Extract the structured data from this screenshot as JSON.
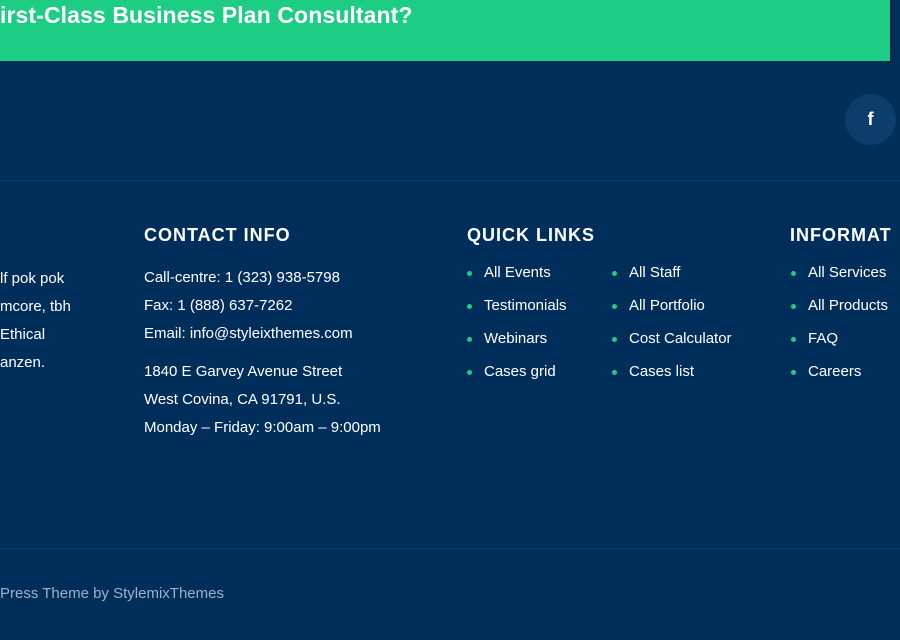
{
  "cta": {
    "title": "irst-Class Business Plan Consultant?"
  },
  "social": {
    "facebook_icon": "f"
  },
  "about": {
    "lines": [
      "lf pok pok",
      "mcore, tbh",
      "Ethical",
      "anzen."
    ]
  },
  "contact": {
    "title": "CONTACT INFO",
    "phone": "Call-centre: 1 (323) 938-5798",
    "fax": "Fax: 1 (888) 637-7262",
    "email": "Email: info@styleixthemes.com",
    "address1": "1840 E Garvey Avenue Street",
    "address2": "West Covina, CA 91791, U.S.",
    "hours": "Monday – Friday: 9:00am – 9:00pm"
  },
  "quick_links": {
    "title": "QUICK LINKS",
    "col1": [
      "All Events",
      "Testimonials",
      "Webinars",
      "Cases grid"
    ],
    "col2": [
      "All Staff",
      "All Portfolio",
      "Cost Calculator",
      "Cases list"
    ]
  },
  "information": {
    "title": "INFORMAT",
    "items": [
      "All Services",
      "All Products",
      "FAQ",
      "Careers"
    ]
  },
  "footer": {
    "copyright": "Press Theme by StylemixThemes"
  },
  "colors": {
    "background": "#002e5b",
    "accent": "#1ecd84"
  }
}
